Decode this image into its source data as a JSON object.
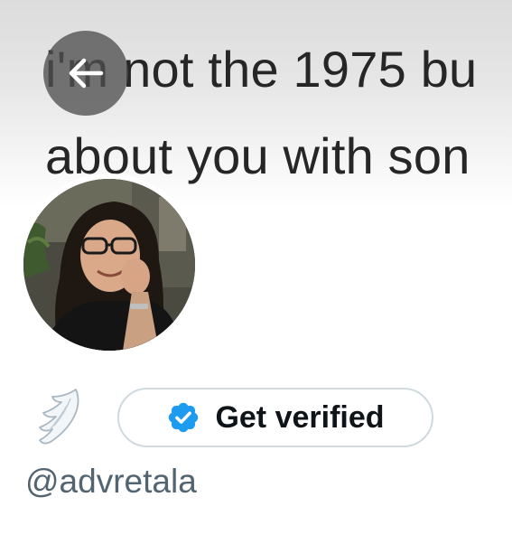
{
  "header": {
    "banner_line_1": "i'm not the 1975 bu",
    "banner_line_2": "about you with son"
  },
  "profile": {
    "handle": "@advretala",
    "bio_emoji": "wing-emoji",
    "get_verified_label": "Get verified"
  },
  "icons": {
    "back": "arrow-left-icon",
    "verified": "verified-badge-icon"
  },
  "colors": {
    "verified_badge": "#1d9bf0",
    "button_border": "#cfd9de",
    "handle_text": "#536471",
    "primary_text": "#0f1419"
  }
}
